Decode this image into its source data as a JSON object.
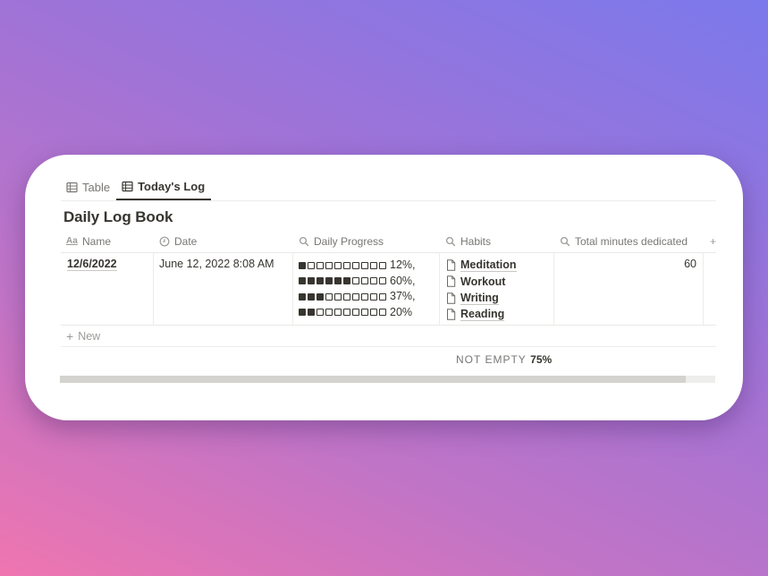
{
  "tabs": [
    {
      "label": "Table",
      "icon": "table-icon",
      "active": false
    },
    {
      "label": "Today's Log",
      "icon": "table-icon",
      "active": true
    }
  ],
  "title": "Daily Log Book",
  "columns": [
    {
      "label": "Name",
      "icon": "text-aa-icon"
    },
    {
      "label": "Date",
      "icon": "clock-icon"
    },
    {
      "label": "Daily Progress",
      "icon": "search-icon"
    },
    {
      "label": "Habits",
      "icon": "search-icon"
    },
    {
      "label": "Total minutes dedicated",
      "icon": "search-icon"
    },
    {
      "label": "+",
      "icon": "plus-icon"
    }
  ],
  "row": {
    "name": "12/6/2022",
    "date": "June 12, 2022 8:08 AM",
    "progress": [
      {
        "filled": 1,
        "total": 10,
        "label": "12%,"
      },
      {
        "filled": 6,
        "total": 10,
        "label": "60%,"
      },
      {
        "filled": 3,
        "total": 10,
        "label": "37%,"
      },
      {
        "filled": 2,
        "total": 10,
        "label": "20%"
      }
    ],
    "habits": [
      "Meditation",
      "Workout",
      "Writing",
      "Reading"
    ],
    "total_minutes": "60"
  },
  "new_label": "New",
  "calculation": {
    "label": "NOT EMPTY",
    "value": "75%"
  },
  "scrollbar": {
    "position": 0.955
  },
  "colors": {
    "text": "#37352f",
    "muted": "#787774",
    "border": "#e9e9e7"
  }
}
